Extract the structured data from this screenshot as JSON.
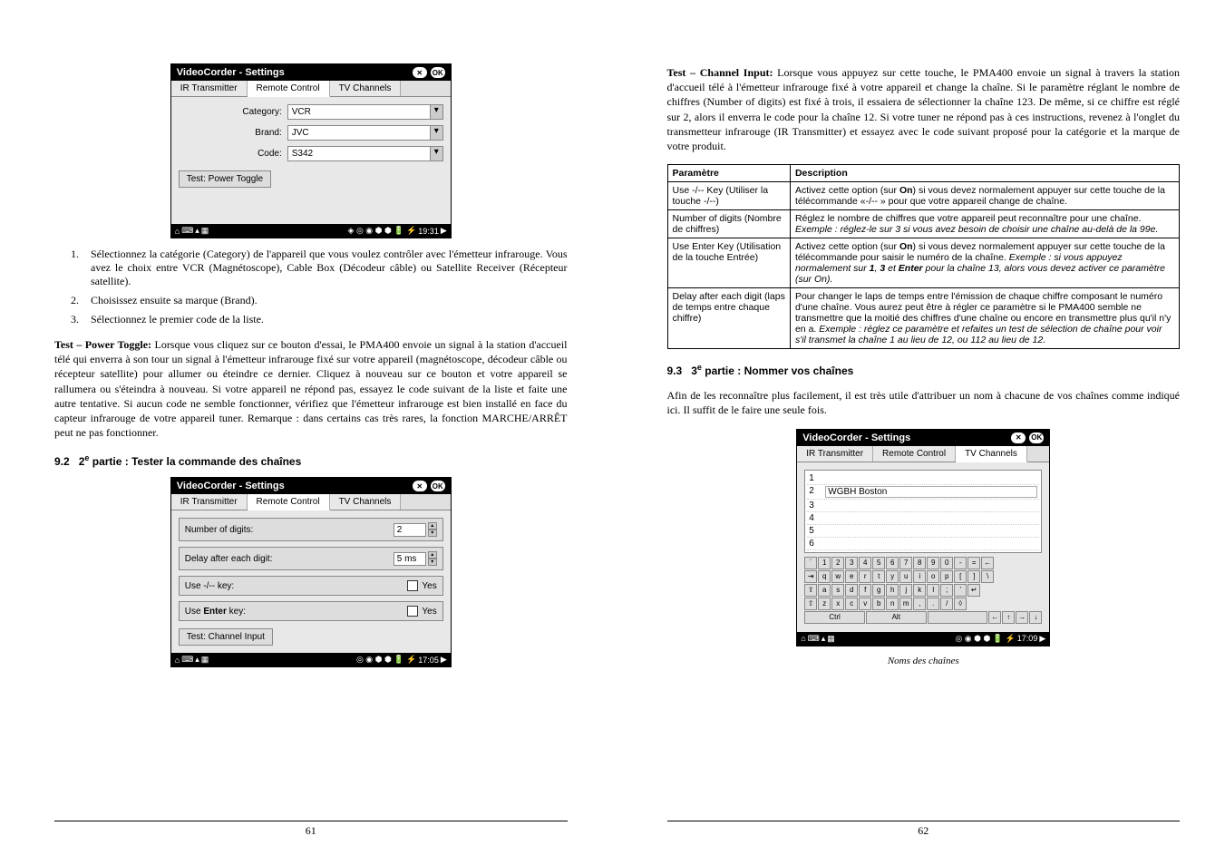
{
  "left_page": {
    "number": "61",
    "screenshot1": {
      "title": "VideoCorder - Settings",
      "tabs": [
        "IR Transmitter",
        "Remote Control",
        "TV Channels"
      ],
      "active_tab_index": 1,
      "category_label": "Category:",
      "category_value": "VCR",
      "brand_label": "Brand:",
      "brand_value": "JVC",
      "code_label": "Code:",
      "code_value": "S342",
      "test_button": "Test: Power Toggle",
      "time": "19:31",
      "ok_label": "OK",
      "close_label": "✕"
    },
    "list": [
      "Sélectionnez la catégorie (Category) de l'appareil que vous voulez contrôler avec l'émetteur infrarouge. Vous avez le choix entre VCR (Magnétoscope), Cable Box (Décodeur câble) ou Satellite Receiver (Récepteur satellite).",
      "Choisissez ensuite sa marque (Brand).",
      "Sélectionnez le premier code de la liste."
    ],
    "test_power_label": "Test – Power Toggle:",
    "test_power_text": " Lorsque vous cliquez sur ce bouton d'essai, le PMA400 envoie un signal à la station d'accueil télé qui enverra à son tour un signal à l'émetteur infrarouge fixé sur votre appareil (magnétoscope, décodeur câble ou récepteur satellite) pour allumer ou éteindre ce dernier. Cliquez à nouveau sur ce bouton et votre appareil se rallumera ou s'éteindra à nouveau. Si votre appareil ne répond pas, essayez le code suivant de la liste et faite une autre tentative. Si aucun code ne semble fonctionner, vérifiez que l'émetteur infrarouge est bien installé en face du capteur infrarouge de votre appareil tuner. Remarque : dans certains cas très rares, la fonction MARCHE/ARRÊT peut ne pas fonctionner.",
    "section_label": "9.2    2ᵉ partie : Tester la commande des chaînes",
    "screenshot2": {
      "title": "VideoCorder - Settings",
      "tabs": [
        "IR Transmitter",
        "Remote Control",
        "TV Channels"
      ],
      "active_tab_index": 1,
      "num_digits_label": "Number of digits:",
      "num_digits_value": "2",
      "delay_label": "Delay after each digit:",
      "delay_value": "5 ms",
      "use_key_label": "Use -/-- key:",
      "use_enter_label": "Use Enter key:",
      "yes": "Yes",
      "test_button": "Test: Channel Input",
      "time": "17:05",
      "ok_label": "OK",
      "close_label": "✕"
    }
  },
  "right_page": {
    "number": "62",
    "test_channel_label": "Test – Channel Input:",
    "test_channel_text": " Lorsque vous appuyez sur cette touche, le PMA400 envoie un signal à travers la station d'accueil télé à l'émetteur infrarouge fixé à votre appareil et change la chaîne. Si le paramètre réglant le nombre de chiffres (Number of digits) est fixé à trois, il essaiera de sélectionner la chaîne 123. De même, si ce chiffre est réglé sur 2, alors il enverra le code pour la chaîne 12. Si votre tuner ne répond pas à ces instructions, revenez à l'onglet du transmetteur infrarouge (IR Transmitter) et essayez avec le code suivant proposé pour la catégorie et la marque de votre produit.",
    "table": {
      "headers": [
        "Paramètre",
        "Description"
      ],
      "rows": [
        {
          "p": "Use -/-- Key (Utiliser la touche -/--)",
          "d": "Activez cette option (sur <b>On</b>) si vous devez normalement appuyer sur cette touche de la télécommande «-/-- » pour que votre appareil change de chaîne."
        },
        {
          "p": "Number of digits (Nombre de chiffres)",
          "d": "Réglez le nombre de chiffres que votre appareil peut reconnaître pour une chaîne. <em>Exemple : réglez-le sur 3 si vous avez besoin de choisir une chaîne au-delà de la 99e.</em>"
        },
        {
          "p": "Use Enter Key (Utilisation de la touche Entrée)",
          "d": "Activez cette option (sur <b>On</b>) si vous devez normalement appuyer sur cette touche de la télécommande pour saisir le numéro de la chaîne. <em>Exemple : si vous appuyez normalement sur <b>1</b>, <b>3</b> et <b>Enter</b> pour la chaîne 13, alors vous devez activer ce paramètre (sur On).</em>"
        },
        {
          "p": "Delay after each digit (laps de temps entre chaque chiffre)",
          "d": "Pour changer le laps de temps entre l'émission de chaque chiffre composant le numéro d'une chaîne. Vous aurez peut être à régler ce paramètre si le PMA400 semble ne transmettre que la moitié des chiffres d'une chaîne ou encore en transmettre plus qu'il n'y en a. <em>Exemple : réglez ce paramètre et refaites un test de sélection de chaîne pour voir s'il transmet la chaîne 1 au lieu de 12, ou 112 au lieu de 12.</em>"
        }
      ]
    },
    "section_label": "9.3    3ᵉ partie : Nommer vos chaînes",
    "intro_text": "Afin de les reconnaître plus facilement, il est très utile d'attribuer un nom à chacune de vos chaînes comme indiqué ici. Il suffit de le faire une seule fois.",
    "screenshot3": {
      "title": "VideoCorder - Settings",
      "tabs": [
        "IR Transmitter",
        "Remote Control",
        "TV Channels"
      ],
      "active_tab_index": 2,
      "channels": [
        {
          "n": "1",
          "name": ""
        },
        {
          "n": "2",
          "name": "WGBH Boston"
        },
        {
          "n": "3",
          "name": ""
        },
        {
          "n": "4",
          "name": ""
        },
        {
          "n": "5",
          "name": ""
        },
        {
          "n": "6",
          "name": ""
        }
      ],
      "kb_rows": [
        [
          "´",
          "1",
          "2",
          "3",
          "4",
          "5",
          "6",
          "7",
          "8",
          "9",
          "0",
          "-",
          "=",
          "←"
        ],
        [
          "⇥",
          "q",
          "w",
          "e",
          "r",
          "t",
          "y",
          "u",
          "i",
          "o",
          "p",
          "[",
          "]",
          "\\"
        ],
        [
          "⇪",
          "a",
          "s",
          "d",
          "f",
          "g",
          "h",
          "j",
          "k",
          "l",
          ";",
          "'",
          "↵"
        ],
        [
          "⇧",
          "z",
          "x",
          "c",
          "v",
          "b",
          "n",
          "m",
          ",",
          ".",
          "/",
          "◊"
        ],
        [
          "Ctrl",
          "Alt",
          " ",
          "←",
          "↑",
          "→",
          "↓"
        ]
      ],
      "time": "17:09",
      "ok_label": "OK",
      "close_label": "✕"
    },
    "caption": "Noms des chaînes"
  }
}
